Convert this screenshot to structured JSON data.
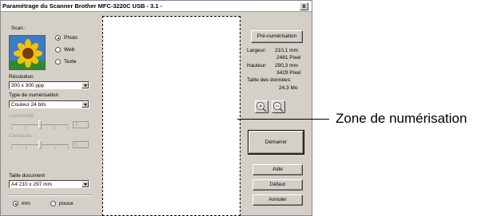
{
  "window": {
    "title": "Paramétrage du Scanner Brother MFC-3220C USB - 3.1 -",
    "close_label": "x"
  },
  "scan": {
    "label": "Scan :",
    "options": [
      "Photo",
      "Web",
      "Texte"
    ],
    "selected": "Photo"
  },
  "resolution": {
    "label": "Résolution",
    "value": "300 x 300 ppp"
  },
  "scan_type": {
    "label": "Type de numérisation",
    "value": "Couleur 24 bits"
  },
  "brightness": {
    "label": "Luminosité",
    "value": "0"
  },
  "contrast": {
    "label": "Contraste",
    "value": "0"
  },
  "doc_size": {
    "label": "Taille document",
    "value": "A4 210 x 297 mm"
  },
  "units": {
    "options": [
      "mm",
      "pouce"
    ],
    "selected": "mm"
  },
  "buttons": {
    "prescan": "Pré-numérisation",
    "start": "Démarrer",
    "help": "Aide",
    "default": "Défaut",
    "cancel": "Annuler"
  },
  "info": {
    "width_label": "Largeur:",
    "width_mm": "210,1 mm",
    "width_px": "2481 Pixel",
    "height_label": "Hauteur:",
    "height_mm": "290,3 mm",
    "height_px": "3429 Pixel",
    "data_size_label": "Taille des données:",
    "data_size": "24,3 Mo"
  },
  "callout": "Zone de numérisation",
  "colors": {
    "window_bg": "#d4d0c8",
    "preview_sky": "#3a7cc8",
    "flower_petal": "#f2c400",
    "flower_center": "#7a3b10",
    "grass": "#2f8a2f"
  }
}
